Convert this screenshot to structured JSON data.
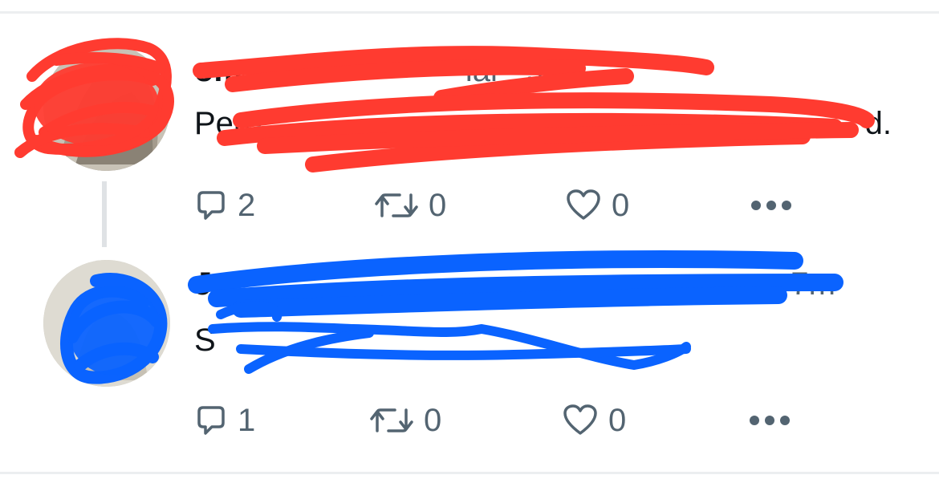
{
  "tweets": [
    {
      "header_visible": "om",
      "handle_visible": "@",
      "time_visible": "ial · 9m",
      "body_visible": "Pere",
      "body_end_visible": "d.",
      "reply_count": "2",
      "retweet_count": "0",
      "like_count": "0"
    },
    {
      "header_visible": "J",
      "time_visible": "7m",
      "body_visible": "S",
      "reply_count": "1",
      "retweet_count": "0",
      "like_count": "0"
    }
  ],
  "colors": {
    "action_gray": "#536471",
    "thread_line": "#dfe2e5",
    "divider": "#eceef0",
    "redaction_red": "#ff3b30",
    "redaction_blue": "#0a63ff"
  },
  "icons": {
    "reply": "reply-icon",
    "retweet": "retweet-icon",
    "like": "heart-icon",
    "more": "more-icon"
  }
}
